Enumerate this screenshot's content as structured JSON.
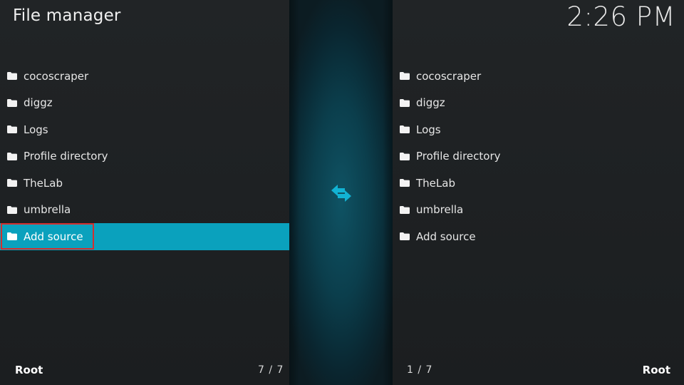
{
  "header": {
    "title": "File manager",
    "clock": "2:26 PM"
  },
  "left_panel": {
    "items": [
      {
        "label": "cocoscraper",
        "icon": "folder-icon"
      },
      {
        "label": "diggz",
        "icon": "folder-icon"
      },
      {
        "label": "Logs",
        "icon": "folder-icon"
      },
      {
        "label": "Profile directory",
        "icon": "folder-icon"
      },
      {
        "label": "TheLab",
        "icon": "folder-icon"
      },
      {
        "label": "umbrella",
        "icon": "folder-icon"
      },
      {
        "label": "Add source",
        "icon": "folder-icon",
        "selected": true
      }
    ],
    "footer_label": "Root",
    "footer_count": "7 / 7"
  },
  "right_panel": {
    "items": [
      {
        "label": "cocoscraper",
        "icon": "folder-icon"
      },
      {
        "label": "diggz",
        "icon": "folder-icon"
      },
      {
        "label": "Logs",
        "icon": "folder-icon"
      },
      {
        "label": "Profile directory",
        "icon": "folder-icon"
      },
      {
        "label": "TheLab",
        "icon": "folder-icon"
      },
      {
        "label": "umbrella",
        "icon": "folder-icon"
      },
      {
        "label": "Add source",
        "icon": "folder-icon"
      }
    ],
    "footer_label": "Root",
    "footer_count": "1 / 7"
  },
  "center": {
    "icon": "swap-arrows-icon"
  },
  "colors": {
    "accent": "#0aa1bd",
    "highlight_border": "#d32f2f",
    "swap_icon": "#12b2d3"
  }
}
